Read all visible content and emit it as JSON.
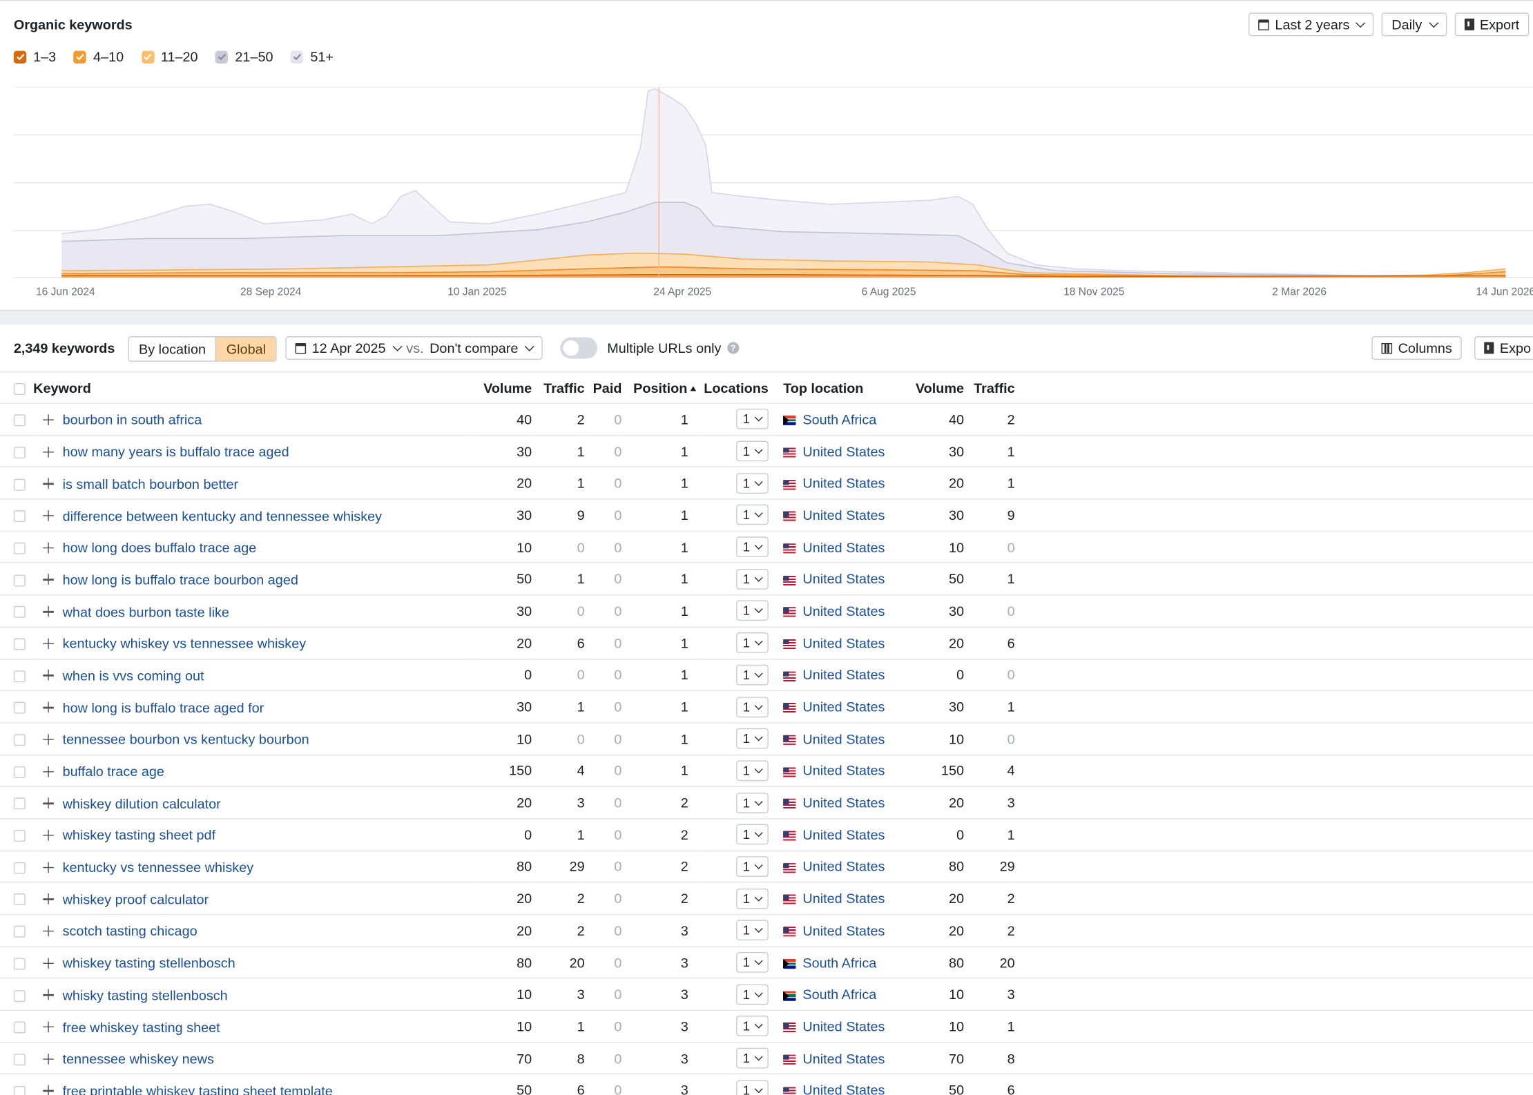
{
  "header": {
    "title": "Organic keywords",
    "period": "Last 2 years",
    "granularity": "Daily",
    "export_label": "Export"
  },
  "legend": [
    {
      "label": "1–3",
      "checked": true,
      "color": "#d66b0c"
    },
    {
      "label": "4–10",
      "checked": true,
      "color": "#f59a2e"
    },
    {
      "label": "11–20",
      "checked": true,
      "color": "#fbbf6a"
    },
    {
      "label": "21–50",
      "checked": true,
      "color": "#c8cad8"
    },
    {
      "label": "51+",
      "checked": true,
      "color": "#e4e5ee"
    }
  ],
  "chart_data": {
    "type": "area",
    "x_tick_labels": [
      "16 Jun 2024",
      "28 Sep 2024",
      "10 Jan 2025",
      "24 Apr 2025",
      "6 Aug 2025",
      "18 Nov 2025",
      "2 Mar 2026",
      "14 Jun 2026"
    ],
    "stacked": true,
    "grid": true,
    "series_order_bottom_to_top": [
      "1–3",
      "4–10",
      "11–20",
      "21–50",
      "51+"
    ]
  },
  "toolbar": {
    "count": "2,349 keywords",
    "by_location": "By location",
    "global": "Global",
    "date": "12 Apr 2025",
    "vs": "vs.",
    "compare": "Don't compare",
    "multiple_urls": "Multiple URLs only",
    "help": "?",
    "columns": "Columns",
    "export": "Expo"
  },
  "table": {
    "headers": {
      "keyword": "Keyword",
      "volume": "Volume",
      "traffic": "Traffic",
      "paid": "Paid",
      "position": "Position",
      "locations": "Locations",
      "top_location": "Top location",
      "volume2": "Volume",
      "traffic2": "Traffic"
    },
    "rows": [
      {
        "keyword": "bourbon in south africa",
        "volume": "40",
        "traffic": "2",
        "paid": "0",
        "position": "1",
        "locations": "1",
        "flag": "za",
        "country": "South Africa",
        "volume2": "40",
        "traffic2": "2"
      },
      {
        "keyword": "how many years is buffalo trace aged",
        "volume": "30",
        "traffic": "1",
        "paid": "0",
        "position": "1",
        "locations": "1",
        "flag": "us",
        "country": "United States",
        "volume2": "30",
        "traffic2": "1"
      },
      {
        "keyword": "is small batch bourbon better",
        "volume": "20",
        "traffic": "1",
        "paid": "0",
        "position": "1",
        "locations": "1",
        "flag": "us",
        "country": "United States",
        "volume2": "20",
        "traffic2": "1"
      },
      {
        "keyword": "difference between kentucky and tennessee whiskey",
        "volume": "30",
        "traffic": "9",
        "paid": "0",
        "position": "1",
        "locations": "1",
        "flag": "us",
        "country": "United States",
        "volume2": "30",
        "traffic2": "9"
      },
      {
        "keyword": "how long does buffalo trace age",
        "volume": "10",
        "traffic": "0",
        "paid": "0",
        "position": "1",
        "locations": "1",
        "flag": "us",
        "country": "United States",
        "volume2": "10",
        "traffic2": "0"
      },
      {
        "keyword": "how long is buffalo trace bourbon aged",
        "volume": "50",
        "traffic": "1",
        "paid": "0",
        "position": "1",
        "locations": "1",
        "flag": "us",
        "country": "United States",
        "volume2": "50",
        "traffic2": "1"
      },
      {
        "keyword": "what does burbon taste like",
        "volume": "30",
        "traffic": "0",
        "paid": "0",
        "position": "1",
        "locations": "1",
        "flag": "us",
        "country": "United States",
        "volume2": "30",
        "traffic2": "0"
      },
      {
        "keyword": "kentucky whiskey vs tennessee whiskey",
        "volume": "20",
        "traffic": "6",
        "paid": "0",
        "position": "1",
        "locations": "1",
        "flag": "us",
        "country": "United States",
        "volume2": "20",
        "traffic2": "6"
      },
      {
        "keyword": "when is vvs coming out",
        "volume": "0",
        "traffic": "0",
        "paid": "0",
        "position": "1",
        "locations": "1",
        "flag": "us",
        "country": "United States",
        "volume2": "0",
        "traffic2": "0"
      },
      {
        "keyword": "how long is buffalo trace aged for",
        "volume": "30",
        "traffic": "1",
        "paid": "0",
        "position": "1",
        "locations": "1",
        "flag": "us",
        "country": "United States",
        "volume2": "30",
        "traffic2": "1"
      },
      {
        "keyword": "tennessee bourbon vs kentucky bourbon",
        "volume": "10",
        "traffic": "0",
        "paid": "0",
        "position": "1",
        "locations": "1",
        "flag": "us",
        "country": "United States",
        "volume2": "10",
        "traffic2": "0"
      },
      {
        "keyword": "buffalo trace age",
        "volume": "150",
        "traffic": "4",
        "paid": "0",
        "position": "1",
        "locations": "1",
        "flag": "us",
        "country": "United States",
        "volume2": "150",
        "traffic2": "4"
      },
      {
        "keyword": "whiskey dilution calculator",
        "volume": "20",
        "traffic": "3",
        "paid": "0",
        "position": "2",
        "locations": "1",
        "flag": "us",
        "country": "United States",
        "volume2": "20",
        "traffic2": "3"
      },
      {
        "keyword": "whiskey tasting sheet pdf",
        "volume": "0",
        "traffic": "1",
        "paid": "0",
        "position": "2",
        "locations": "1",
        "flag": "us",
        "country": "United States",
        "volume2": "0",
        "traffic2": "1"
      },
      {
        "keyword": "kentucky vs tennessee whiskey",
        "volume": "80",
        "traffic": "29",
        "paid": "0",
        "position": "2",
        "locations": "1",
        "flag": "us",
        "country": "United States",
        "volume2": "80",
        "traffic2": "29"
      },
      {
        "keyword": "whiskey proof calculator",
        "volume": "20",
        "traffic": "2",
        "paid": "0",
        "position": "2",
        "locations": "1",
        "flag": "us",
        "country": "United States",
        "volume2": "20",
        "traffic2": "2"
      },
      {
        "keyword": "scotch tasting chicago",
        "volume": "20",
        "traffic": "2",
        "paid": "0",
        "position": "3",
        "locations": "1",
        "flag": "us",
        "country": "United States",
        "volume2": "20",
        "traffic2": "2"
      },
      {
        "keyword": "whiskey tasting stellenbosch",
        "volume": "80",
        "traffic": "20",
        "paid": "0",
        "position": "3",
        "locations": "1",
        "flag": "za",
        "country": "South Africa",
        "volume2": "80",
        "traffic2": "20"
      },
      {
        "keyword": "whisky tasting stellenbosch",
        "volume": "10",
        "traffic": "3",
        "paid": "0",
        "position": "3",
        "locations": "1",
        "flag": "za",
        "country": "South Africa",
        "volume2": "10",
        "traffic2": "3"
      },
      {
        "keyword": "free whiskey tasting sheet",
        "volume": "10",
        "traffic": "1",
        "paid": "0",
        "position": "3",
        "locations": "1",
        "flag": "us",
        "country": "United States",
        "volume2": "10",
        "traffic2": "1"
      },
      {
        "keyword": "tennessee whiskey news",
        "volume": "70",
        "traffic": "8",
        "paid": "0",
        "position": "3",
        "locations": "1",
        "flag": "us",
        "country": "United States",
        "volume2": "70",
        "traffic2": "8"
      },
      {
        "keyword": "free printable whiskey tasting sheet template",
        "volume": "50",
        "traffic": "6",
        "paid": "0",
        "position": "3",
        "locations": "1",
        "flag": "us",
        "country": "United States",
        "volume2": "50",
        "traffic2": "6"
      }
    ]
  }
}
